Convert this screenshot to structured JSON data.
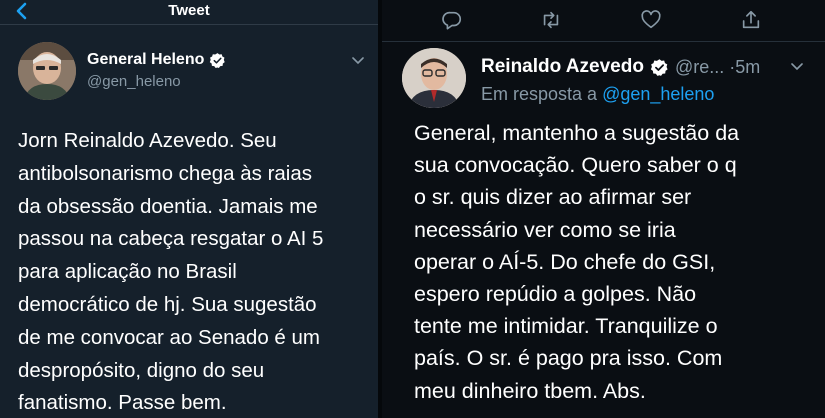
{
  "left_panel": {
    "header": {
      "title": "Tweet",
      "back_icon": "chevron-left-icon"
    },
    "author": {
      "name": "General Heleno",
      "handle": "@gen_heleno",
      "verified_icon": "verified-badge-icon"
    },
    "tweet_text": "Jorn Reinaldo Azevedo. Seu\nantibolsonarismo chega às raias\nda obsessão doentia. Jamais me\npassou na cabeça resgatar o AI 5\npara aplicação no Brasil\ndemocrático de hj. Sua sugestão\nde me convocar ao Senado é um\ndespropósito, digno do seu\nfanatismo. Passe bem.",
    "colors": {
      "background": "#15202b",
      "secondary_text": "#8899a6",
      "accent": "#1da1f2"
    }
  },
  "right_panel": {
    "actions": [
      "reply-icon",
      "retweet-icon",
      "like-icon",
      "share-icon"
    ],
    "author": {
      "name": "Reinaldo Azevedo",
      "handle_time": "@re... ·5m",
      "verified_icon": "verified-badge-icon"
    },
    "reply_prefix": "Em resposta a",
    "reply_mention": "@gen_heleno",
    "tweet_text": "General, mantenho a sugestão da\nsua convocação. Quero saber o q\no sr. quis dizer ao afirmar ser\nnecessário ver como se iria\noperar o AÍ-5. Do chefe do GSI,\nespero repúdio a golpes. Não\ntente me intimidar. Tranquilize o\npaís. O sr. é pago pra isso. Com\nmeu dinheiro tbem. Abs.",
    "colors": {
      "background": "#0a0e13",
      "mention": "#1da1f2"
    }
  }
}
